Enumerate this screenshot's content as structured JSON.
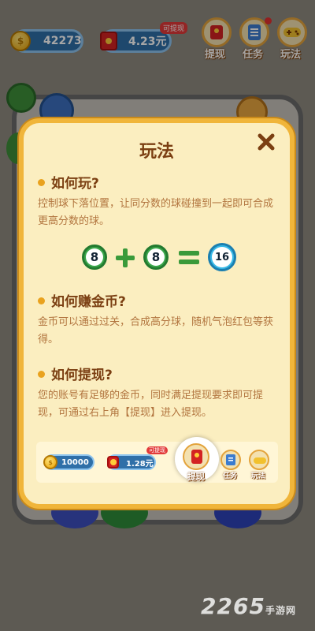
{
  "topbar": {
    "coins": "42273",
    "cash": "4.23元",
    "cash_tag": "可提现",
    "buttons": [
      {
        "label": "提现",
        "icon": "red-envelope-icon"
      },
      {
        "label": "任务",
        "icon": "task-list-icon"
      },
      {
        "label": "玩法",
        "icon": "gamepad-icon"
      }
    ]
  },
  "modal": {
    "title": "玩法",
    "sections": [
      {
        "heading": "如何玩?",
        "text": "控制球下落位置，让同分数的球碰撞到一起即可合成更高分数的球。"
      },
      {
        "heading": "如何赚金币?",
        "text": "金币可以通过过关，合成高分球，随机气泡红包等获得。"
      },
      {
        "heading": "如何提现?",
        "text": "您的账号有足够的金币，同时满足提现要求即可提现，可通过右上角【提现】进入提现。"
      }
    ],
    "equation": {
      "a": "8",
      "b": "8",
      "result": "16"
    },
    "preview": {
      "coins": "10000",
      "cash": "1.28元",
      "cash_tag": "可提现",
      "withdraw": "提现",
      "task": "任务",
      "play": "玩法"
    }
  },
  "colors": {
    "accent": "#f0b53a",
    "title": "#7b3f12",
    "text": "#b2753f"
  },
  "watermark": {
    "brand": "2265",
    "site": "手游网"
  }
}
